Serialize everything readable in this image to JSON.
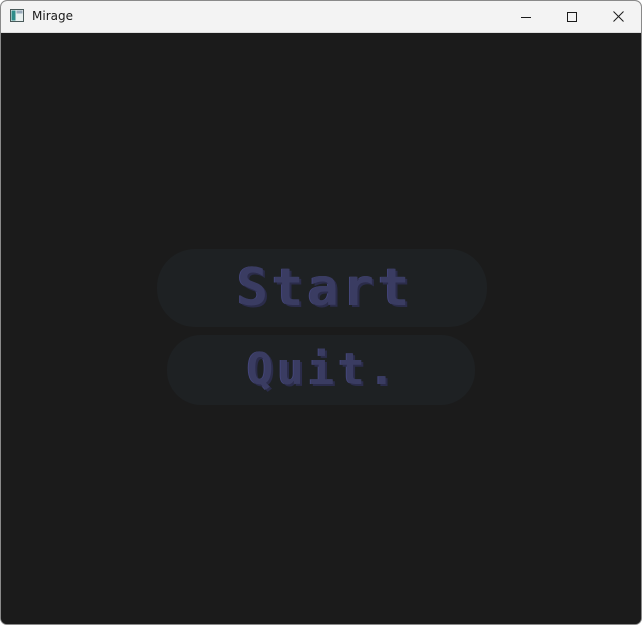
{
  "window": {
    "title": "Mirage",
    "icon": "app-window-icon",
    "controls": {
      "minimize_icon": "minimize-icon",
      "maximize_icon": "maximize-icon",
      "close_icon": "close-icon"
    }
  },
  "menu": {
    "start_label": "Start",
    "quit_label": "Quit."
  },
  "colors": {
    "background": "#1b1b1b",
    "button_bg": "#1e2123",
    "button_text": "#3a3c62"
  }
}
